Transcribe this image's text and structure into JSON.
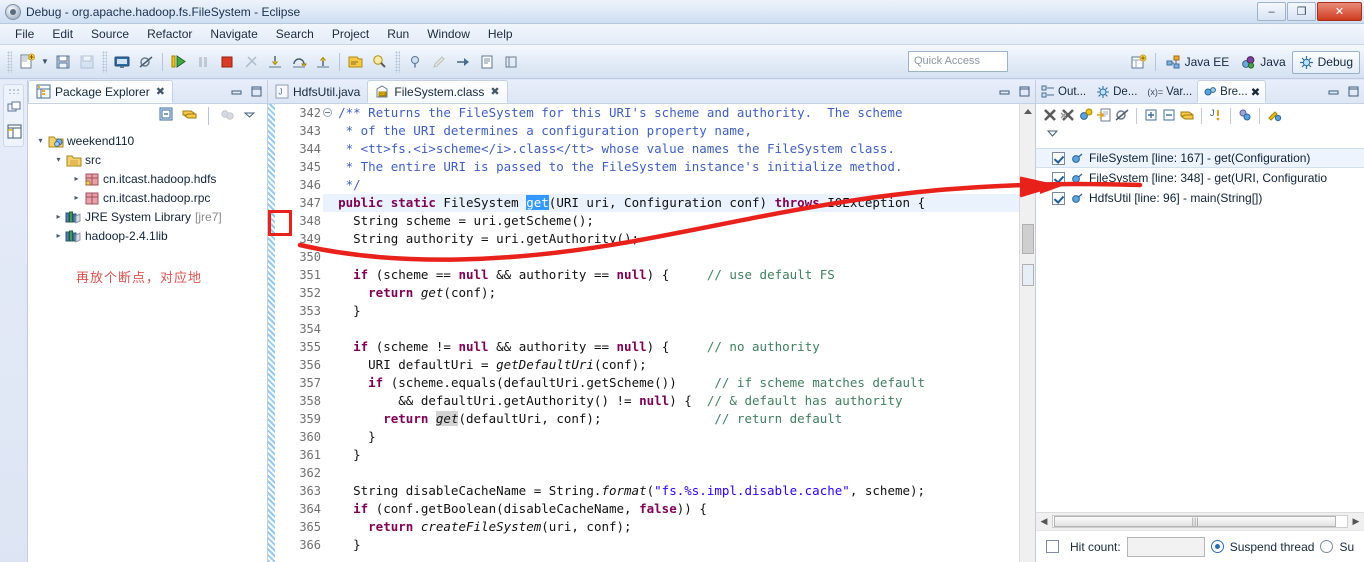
{
  "window": {
    "title": "Debug - org.apache.hadoop.fs.FileSystem - Eclipse",
    "minimize": "–",
    "restore": "❐",
    "close": "✕"
  },
  "menubar": {
    "items": [
      "File",
      "Edit",
      "Source",
      "Refactor",
      "Navigate",
      "Search",
      "Project",
      "Run",
      "Window",
      "Help"
    ]
  },
  "toolbar": {
    "quick_access_placeholder": "Quick Access",
    "perspectives": [
      {
        "label": "Java EE",
        "active": false
      },
      {
        "label": "Java",
        "active": false
      },
      {
        "label": "Debug",
        "active": true
      }
    ]
  },
  "explorer": {
    "tab_label": "Package Explorer",
    "tab_close": "✖",
    "tree": [
      {
        "label": "weekend110",
        "indent": 0,
        "twisty": "▾",
        "icon": "java-project-icon",
        "dim": ""
      },
      {
        "label": "src",
        "indent": 1,
        "twisty": "▾",
        "icon": "source-folder-icon",
        "dim": ""
      },
      {
        "label": "cn.itcast.hadoop.hdfs",
        "indent": 2,
        "twisty": "▸",
        "icon": "package-icon",
        "dim": ""
      },
      {
        "label": "cn.itcast.hadoop.rpc",
        "indent": 2,
        "twisty": "▸",
        "icon": "package-icon",
        "dim": ""
      },
      {
        "label": "JRE System Library",
        "indent": 1,
        "twisty": "▸",
        "icon": "library-icon",
        "dim": "[jre7]"
      },
      {
        "label": "hadoop-2.4.1lib",
        "indent": 1,
        "twisty": "▸",
        "icon": "library-icon",
        "dim": ""
      }
    ],
    "annotation": "再放个断点，对应地"
  },
  "editor": {
    "tabs": [
      {
        "label": "HdfsUtil.java",
        "active": false,
        "icon": "java-file-icon",
        "close": ""
      },
      {
        "label": "FileSystem.class",
        "active": true,
        "icon": "class-file-icon",
        "close": "✖"
      }
    ],
    "first_line": 342,
    "highlight_line": 347,
    "breakpoint_line": 348,
    "lines": [
      {
        "n": 342,
        "fold": true,
        "html": "  <span class='jdoc'>/** Returns the FileSystem for this URI's scheme and authority.  The scheme</span>"
      },
      {
        "n": 343,
        "fold": false,
        "html": "   <span class='jdoc'>* of the URI determines a configuration property name,</span>"
      },
      {
        "n": 344,
        "fold": false,
        "html": "   <span class='jdoc'>* &lt;tt&gt;fs.&lt;i&gt;scheme&lt;/i&gt;.class&lt;/tt&gt; whose value names the FileSystem class.</span>"
      },
      {
        "n": 345,
        "fold": false,
        "html": "   <span class='jdoc'>* The entire URI is passed to the FileSystem instance's initialize method.</span>"
      },
      {
        "n": 346,
        "fold": false,
        "html": "   <span class='jdoc'>*/</span>"
      },
      {
        "n": 347,
        "fold": true,
        "html": "  <span class='kw'>public static</span> FileSystem <span class='sel'>get</span>(URI uri, Configuration conf) <span class='kw'>throws</span> IOException {"
      },
      {
        "n": 348,
        "fold": false,
        "html": "    String scheme = uri.getScheme();"
      },
      {
        "n": 349,
        "fold": false,
        "html": "    String authority = uri.getAuthority();"
      },
      {
        "n": 350,
        "fold": false,
        "html": ""
      },
      {
        "n": 351,
        "fold": false,
        "html": "    <span class='kw'>if</span> (scheme == <span class='kw'>null</span> &amp;&amp; authority == <span class='kw'>null</span>) {     <span class='cmt'>// use default FS</span>"
      },
      {
        "n": 352,
        "fold": false,
        "html": "      <span class='kw'>return</span> <span class='ital'>get</span>(conf);"
      },
      {
        "n": 353,
        "fold": false,
        "html": "    }"
      },
      {
        "n": 354,
        "fold": false,
        "html": ""
      },
      {
        "n": 355,
        "fold": false,
        "html": "    <span class='kw'>if</span> (scheme != <span class='kw'>null</span> &amp;&amp; authority == <span class='kw'>null</span>) {     <span class='cmt'>// no authority</span>"
      },
      {
        "n": 356,
        "fold": false,
        "html": "      URI defaultUri = <span class='ital'>getDefaultUri</span>(conf);"
      },
      {
        "n": 357,
        "fold": false,
        "html": "      <span class='kw'>if</span> (scheme.equals(defaultUri.getScheme())     <span class='cmt'>// if scheme matches default</span>"
      },
      {
        "n": 358,
        "fold": false,
        "html": "          &amp;&amp; defaultUri.getAuthority() != <span class='kw'>null</span>) {  <span class='cmt'>// &amp; default has authority</span>"
      },
      {
        "n": 359,
        "fold": false,
        "html": "        <span class='kw'>return</span> <span class='ital selgray'>get</span>(defaultUri, conf);               <span class='cmt'>// return default</span>"
      },
      {
        "n": 360,
        "fold": false,
        "html": "      }"
      },
      {
        "n": 361,
        "fold": false,
        "html": "    }"
      },
      {
        "n": 362,
        "fold": false,
        "html": ""
      },
      {
        "n": 363,
        "fold": false,
        "html": "    String disableCacheName = String.<span class='ital'>format</span>(<span class='str'>\"fs.%s.impl.disable.cache\"</span>, scheme);"
      },
      {
        "n": 364,
        "fold": false,
        "html": "    <span class='kw'>if</span> (conf.getBoolean(disableCacheName, <span class='kw'>false</span>)) {"
      },
      {
        "n": 365,
        "fold": false,
        "html": "      <span class='kw'>return</span> <span class='ital'>createFileSystem</span>(uri, conf);"
      },
      {
        "n": 366,
        "fold": false,
        "html": "    }"
      }
    ]
  },
  "right_panel": {
    "tabs": [
      {
        "label": "Out...",
        "active": false,
        "icon": "outline-icon",
        "close": ""
      },
      {
        "label": "De...",
        "active": false,
        "icon": "debug-icon",
        "close": ""
      },
      {
        "label": "Var...",
        "active": false,
        "icon": "variables-icon",
        "prefix": "(x)=",
        "close": ""
      },
      {
        "label": "Bre...",
        "active": true,
        "icon": "breakpoints-icon",
        "close": "✖"
      }
    ],
    "breakpoints": [
      {
        "label": "FileSystem [line: 167] - get(Configuration)",
        "checked": true,
        "selected": true
      },
      {
        "label": "FileSystem [line: 348] - get(URI, Configuratio",
        "checked": true,
        "selected": false
      },
      {
        "label": "HdfsUtil [line: 96] - main(String[])",
        "checked": true,
        "selected": false
      }
    ],
    "footer": {
      "hit_count_label": "Hit count:",
      "hit_count_value": "",
      "hit_count_checked": false,
      "suspend_thread_label": "Suspend thread",
      "suspend_thread_selected": true,
      "suspend_vm_label": "Su",
      "suspend_vm_selected": false
    }
  },
  "colors": {
    "accent_red": "#e8211b",
    "keyword": "#7f0055",
    "comment": "#3f7f5f",
    "javadoc": "#3f5fbf",
    "string": "#2a00ff",
    "selection": "#3399ff",
    "annotation_red": "#d9534f"
  }
}
